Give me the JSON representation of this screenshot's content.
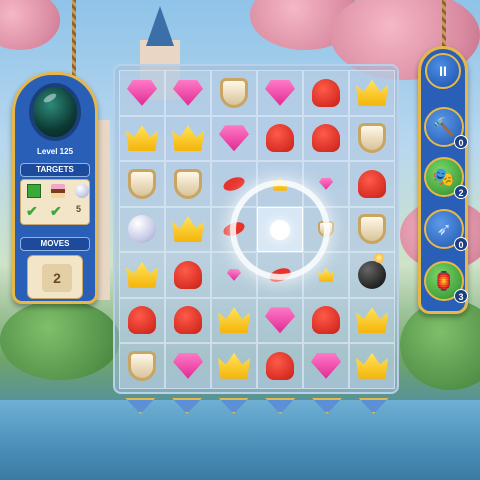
{
  "hud": {
    "level_text": "Level 125",
    "targets_title": "TARGETS",
    "moves_title": "MOVES",
    "moves_left": "2",
    "targets": [
      {
        "name": "grass-tile",
        "status": "done"
      },
      {
        "name": "cake-block",
        "status": "done"
      },
      {
        "name": "pearl",
        "remaining": "5"
      }
    ]
  },
  "controls": {
    "pause_label": "II",
    "boosters": [
      {
        "name": "hammer",
        "glyph": "🔨",
        "count": "0"
      },
      {
        "name": "jester-hat",
        "glyph": "🎭",
        "count": "2"
      },
      {
        "name": "arrow",
        "glyph": "➶",
        "count": "0"
      },
      {
        "name": "cannon",
        "glyph": "🏮",
        "count": "3"
      }
    ]
  },
  "board": {
    "rows": 7,
    "cols": 6,
    "cells": [
      [
        "gem",
        "gem",
        "shield",
        "gem",
        "bell",
        "crown"
      ],
      [
        "crown",
        "crown",
        "gem",
        "bell",
        "bell",
        "shield"
      ],
      [
        "shield",
        "shield",
        "bow",
        "crown-small",
        "gem-small",
        "bell"
      ],
      [
        "pearl",
        "crown",
        "bow",
        "empty-lit",
        "shield-small",
        "shield"
      ],
      [
        "crown",
        "bell",
        "gem-small",
        "bow",
        "crown-small",
        "bomb"
      ],
      [
        "bell",
        "bell",
        "crown",
        "gem",
        "bell",
        "crown"
      ],
      [
        "shield",
        "gem",
        "crown",
        "bell",
        "gem",
        "crown"
      ]
    ]
  },
  "colors": {
    "panel_blue": "#2a5fb8",
    "gold_trim": "#e6b84a"
  }
}
